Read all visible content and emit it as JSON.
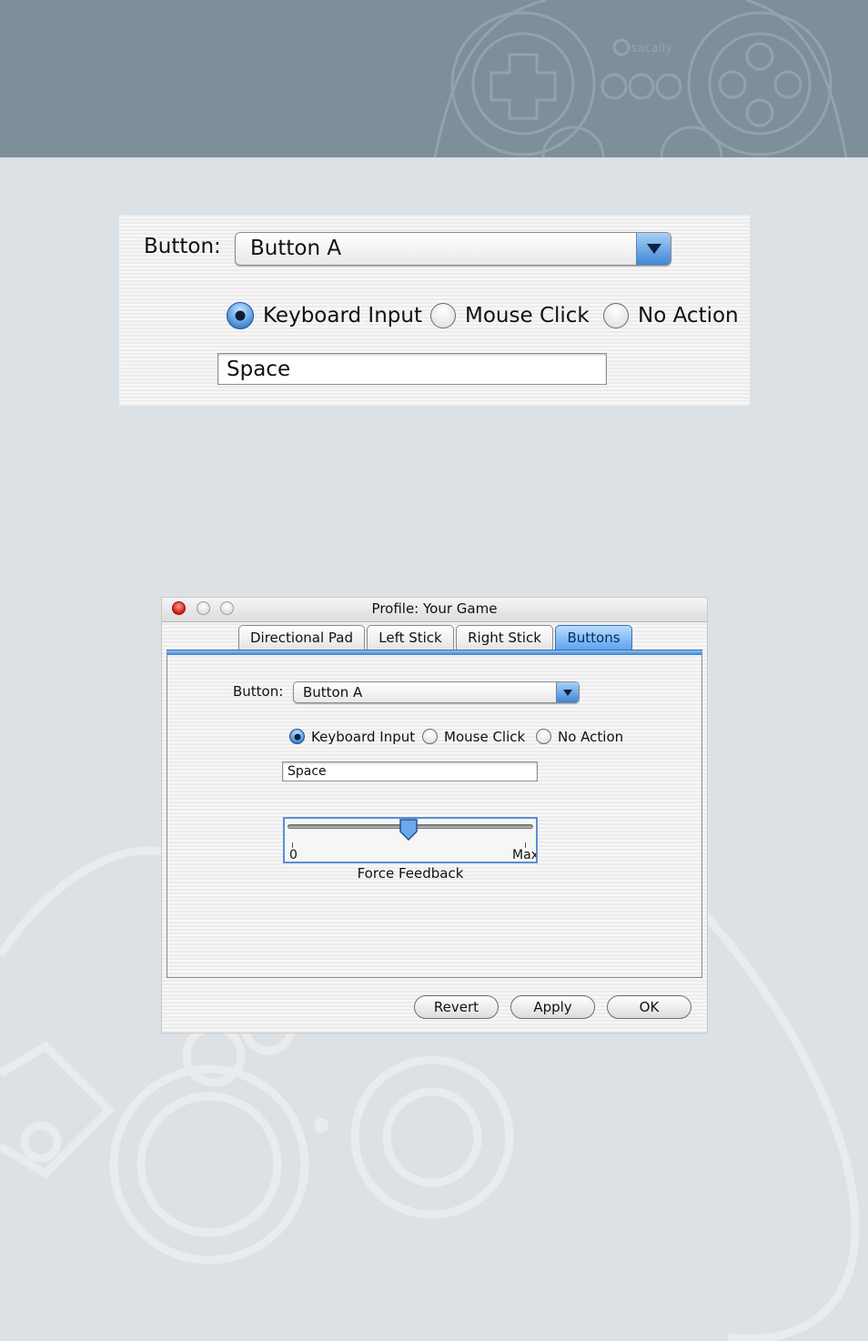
{
  "enlarged_panel": {
    "button_label": "Button:",
    "button_value": "Button A",
    "radio_options": [
      {
        "label": "Keyboard Input",
        "selected": true
      },
      {
        "label": "Mouse Click",
        "selected": false
      },
      {
        "label": "No Action",
        "selected": false
      }
    ],
    "key_field_value": "Space"
  },
  "window": {
    "title": "Profile: Your Game",
    "tabs": [
      {
        "label": "Directional Pad",
        "active": false
      },
      {
        "label": "Left Stick",
        "active": false
      },
      {
        "label": "Right Stick",
        "active": false
      },
      {
        "label": "Buttons",
        "active": true
      }
    ],
    "button_label": "Button:",
    "button_value": "Button A",
    "radio_options": [
      {
        "label": "Keyboard Input",
        "selected": true
      },
      {
        "label": "Mouse Click",
        "selected": false
      },
      {
        "label": "No Action",
        "selected": false
      }
    ],
    "key_field_value": "Space",
    "force_feedback": {
      "label": "Force Feedback",
      "min_label": "0",
      "max_label": "Max",
      "value_fraction": 0.5
    },
    "actions": {
      "revert": "Revert",
      "apply": "Apply",
      "ok": "OK"
    }
  },
  "brand_watermark": "sacally",
  "colors": {
    "header_band": "#7e8f9a",
    "page_background": "#dce1e5",
    "accent_blue": "#5aa2ec",
    "close_red": "#d4180b"
  }
}
